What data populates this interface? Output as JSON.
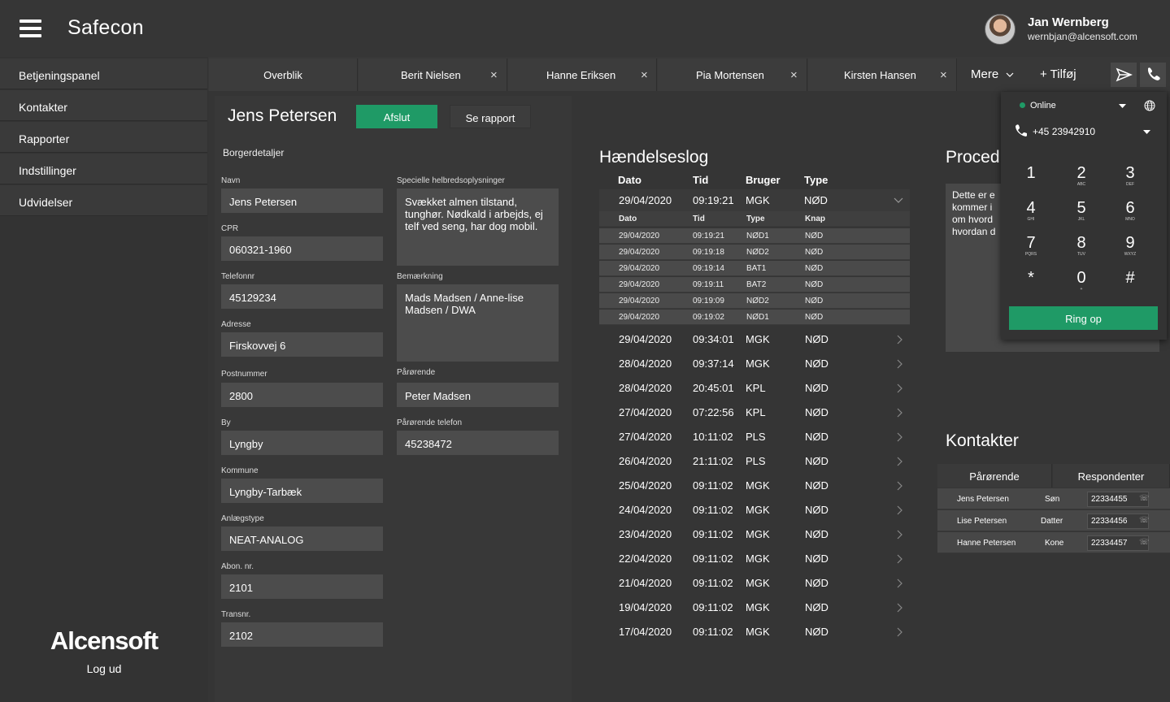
{
  "app": {
    "title": "Safecon"
  },
  "user": {
    "name": "Jan Wernberg",
    "email": "wernbjan@alcensoft.com"
  },
  "sidebar": {
    "items": [
      "Betjeningspanel",
      "Kontakter",
      "Rapporter",
      "Indstillinger",
      "Udvidelser"
    ],
    "logo": "Alcensoft",
    "logout": "Log ud"
  },
  "tabs": {
    "items": [
      {
        "label": "Overblik"
      },
      {
        "label": "Berit Nielsen"
      },
      {
        "label": "Hanne Eriksen"
      },
      {
        "label": "Pia Mortensen"
      },
      {
        "label": "Kirsten Hansen"
      }
    ],
    "close": "×",
    "more": "Mere",
    "add": "+ Tilføj"
  },
  "citizen": {
    "name": "Jens Petersen",
    "end_label": "Afslut",
    "report_label": "Se rapport",
    "section_title": "Borgerdetaljer",
    "fields": [
      {
        "label": "Navn",
        "value": "Jens Petersen"
      },
      {
        "label": "CPR",
        "value": "060321-1960"
      },
      {
        "label": "Telefonnr",
        "value": "45129234"
      },
      {
        "label": "Adresse",
        "value": "Firskovvej 6"
      },
      {
        "label": "Postnummer",
        "value": "2800"
      },
      {
        "label": "By",
        "value": "Lyngby"
      },
      {
        "label": "Kommune",
        "value": "Lyngby-Tarbæk"
      },
      {
        "label": "Anlægstype",
        "value": "NEAT-ANALOG"
      },
      {
        "label": "Abon. nr.",
        "value": "2101"
      },
      {
        "label": "Transnr.",
        "value": "2102"
      }
    ],
    "health_label": "Specielle helbredsoplysninger",
    "health_value": "Svækket almen tilstand, tunghør. Nødkald i arbejds, ej telf ved seng, har dog mobil.",
    "remark_label": "Bemærkning",
    "remark_value": "Mads Madsen / Anne-lise Madsen / DWA",
    "relative_label": "Pårørende",
    "relative_value": "Peter Madsen",
    "relative_phone_label": "Pårørende telefon",
    "relative_phone_value": "45238472"
  },
  "eventlog": {
    "title": "Hændelseslog",
    "headers": [
      "Dato",
      "Tid",
      "Bruger",
      "Type"
    ],
    "expanded": {
      "date": "29/04/2020",
      "time": "09:19:21",
      "user": "MGK",
      "type": "NØD"
    },
    "sub_headers": [
      "Dato",
      "Tid",
      "Type",
      "Knap"
    ],
    "sub_rows": [
      [
        "29/04/2020",
        "09:19:21",
        "NØD1",
        "NØD"
      ],
      [
        "29/04/2020",
        "09:19:18",
        "NØD2",
        "NØD"
      ],
      [
        "29/04/2020",
        "09:19:14",
        "BAT1",
        "NØD"
      ],
      [
        "29/04/2020",
        "09:19:11",
        "BAT2",
        "NØD"
      ],
      [
        "29/04/2020",
        "09:19:09",
        "NØD2",
        "NØD"
      ],
      [
        "29/04/2020",
        "09:19:02",
        "NØD1",
        "NØD"
      ]
    ],
    "rows": [
      [
        "29/04/2020",
        "09:34:01",
        "MGK",
        "NØD"
      ],
      [
        "28/04/2020",
        "09:37:14",
        "MGK",
        "NØD"
      ],
      [
        "28/04/2020",
        "20:45:01",
        "KPL",
        "NØD"
      ],
      [
        "27/04/2020",
        "07:22:56",
        "KPL",
        "NØD"
      ],
      [
        "27/04/2020",
        "10:11:02",
        "PLS",
        "NØD"
      ],
      [
        "26/04/2020",
        "21:11:02",
        "PLS",
        "NØD"
      ],
      [
        "25/04/2020",
        "09:11:02",
        "MGK",
        "NØD"
      ],
      [
        "24/04/2020",
        "09:11:02",
        "MGK",
        "NØD"
      ],
      [
        "23/04/2020",
        "09:11:02",
        "MGK",
        "NØD"
      ],
      [
        "22/04/2020",
        "09:11:02",
        "MGK",
        "NØD"
      ],
      [
        "21/04/2020",
        "09:11:02",
        "MGK",
        "NØD"
      ],
      [
        "19/04/2020",
        "09:11:02",
        "MGK",
        "NØD"
      ],
      [
        "17/04/2020",
        "09:11:02",
        "MGK",
        "NØD"
      ]
    ]
  },
  "procedure": {
    "title": "Proced",
    "text_lines": [
      "Dette er e",
      "kommer i",
      "om hvord",
      "hvordan d"
    ]
  },
  "contacts": {
    "title": "Kontakter",
    "tabs": [
      "Pårørende",
      "Respondenter"
    ],
    "rows": [
      {
        "name": "Jens Petersen",
        "relation": "Søn",
        "phone": "22334455"
      },
      {
        "name": "Lise Petersen",
        "relation": "Datter",
        "phone": "22334456"
      },
      {
        "name": "Hanne Petersen",
        "relation": "Kone",
        "phone": "22334457"
      }
    ]
  },
  "dialer": {
    "status": "Online",
    "phone": "+45 23942910",
    "keys": [
      [
        "1",
        ""
      ],
      [
        "2",
        "ABC"
      ],
      [
        "3",
        "DEF"
      ],
      [
        "4",
        "GHI"
      ],
      [
        "5",
        "JKL"
      ],
      [
        "6",
        "MNO"
      ],
      [
        "7",
        "PQRS"
      ],
      [
        "8",
        "TUV"
      ],
      [
        "9",
        "WXYZ"
      ],
      [
        "*",
        ""
      ],
      [
        "0",
        "+"
      ],
      [
        "#",
        ""
      ]
    ],
    "call_label": "Ring op"
  },
  "colors": {
    "accent": "#1f9a66",
    "background": "#353535",
    "online": "#1f9a66"
  }
}
